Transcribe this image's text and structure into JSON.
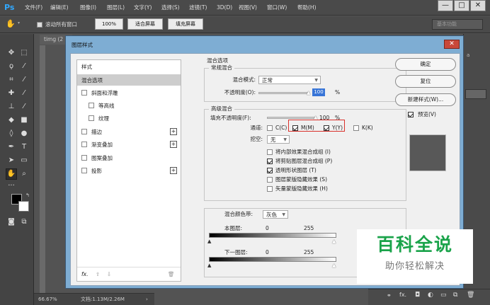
{
  "menubar": {
    "logo": "Ps",
    "items": [
      "文件(F)",
      "编辑(E)",
      "图像(I)",
      "图层(L)",
      "文字(Y)",
      "选择(S)",
      "滤镜(T)",
      "3D(D)",
      "视图(V)",
      "窗口(W)",
      "帮助(H)"
    ],
    "window_buttons": [
      "—",
      "□",
      "✕"
    ]
  },
  "optbar": {
    "scroll_all": "滚动所有窗口",
    "zoom": "100%",
    "fit_screen": "适合屏幕",
    "fill_screen": "填充屏幕",
    "workspace": "基本功能"
  },
  "document": {
    "tab": "timg (2",
    "zoom": "66.67%",
    "doc_info": "文档:1.13M/2.26M"
  },
  "right_panel": {
    "fx_label": "fx."
  },
  "dialog": {
    "title": "图层样式",
    "close": "✕",
    "styles_header": "样式",
    "styles": [
      {
        "label": "混合选项",
        "checkbox": false,
        "plus": false,
        "selected": true,
        "indent": false
      },
      {
        "label": "斜面和浮雕",
        "checkbox": true,
        "plus": false,
        "selected": false,
        "indent": false
      },
      {
        "label": "等高线",
        "checkbox": true,
        "plus": false,
        "selected": false,
        "indent": true
      },
      {
        "label": "纹理",
        "checkbox": true,
        "plus": false,
        "selected": false,
        "indent": true
      },
      {
        "label": "描边",
        "checkbox": true,
        "plus": true,
        "selected": false,
        "indent": false
      },
      {
        "label": "渐变叠加",
        "checkbox": true,
        "plus": true,
        "selected": false,
        "indent": false
      },
      {
        "label": "图案叠加",
        "checkbox": true,
        "plus": false,
        "selected": false,
        "indent": false
      },
      {
        "label": "投影",
        "checkbox": true,
        "plus": true,
        "selected": false,
        "indent": false
      }
    ],
    "bottom_icons": [
      "fx.",
      "⇧",
      "⇩",
      "🗑"
    ],
    "blend": {
      "title": "混合选项",
      "general_title": "常规混合",
      "mode_label": "混合模式:",
      "mode_value": "正常",
      "opacity_label": "不透明度(O):",
      "opacity_value": "100",
      "percent": "%",
      "advanced_title": "高级混合",
      "fill_label": "填充不透明度(F):",
      "fill_value": "100",
      "channels_label": "通道:",
      "channels": [
        {
          "label": "C(C)",
          "checked": false
        },
        {
          "label": "M(M)",
          "checked": true
        },
        {
          "label": "Y(Y)",
          "checked": true
        },
        {
          "label": "K(K)",
          "checked": false
        }
      ],
      "knockout_label": "挖空:",
      "knockout_value": "无",
      "options": [
        {
          "label": "将内部效果混合成组 (I)",
          "checked": false
        },
        {
          "label": "将剪贴图层混合成组 (P)",
          "checked": true
        },
        {
          "label": "透明形状图层 (T)",
          "checked": true
        },
        {
          "label": "图层蒙版隐藏效果 (S)",
          "checked": false
        },
        {
          "label": "矢量蒙版隐藏效果 (H)",
          "checked": false
        }
      ],
      "blend_if_label": "混合颜色带:",
      "blend_if_value": "灰色",
      "this_layer_label": "本图层:",
      "this_layer_min": "0",
      "this_layer_max": "255",
      "underlying_label": "下一图层:",
      "underlying_min": "0",
      "underlying_max": "255"
    },
    "buttons": {
      "ok": "确定",
      "reset": "复位",
      "new_style": "新建样式(W)...",
      "preview_label": "预览(V)",
      "preview_checked": true
    },
    "channels_highlight_color": "#d9312b"
  },
  "watermark": {
    "title": "百科全说",
    "subtitle": "助你轻松解决",
    "color": "#1aa34a"
  }
}
